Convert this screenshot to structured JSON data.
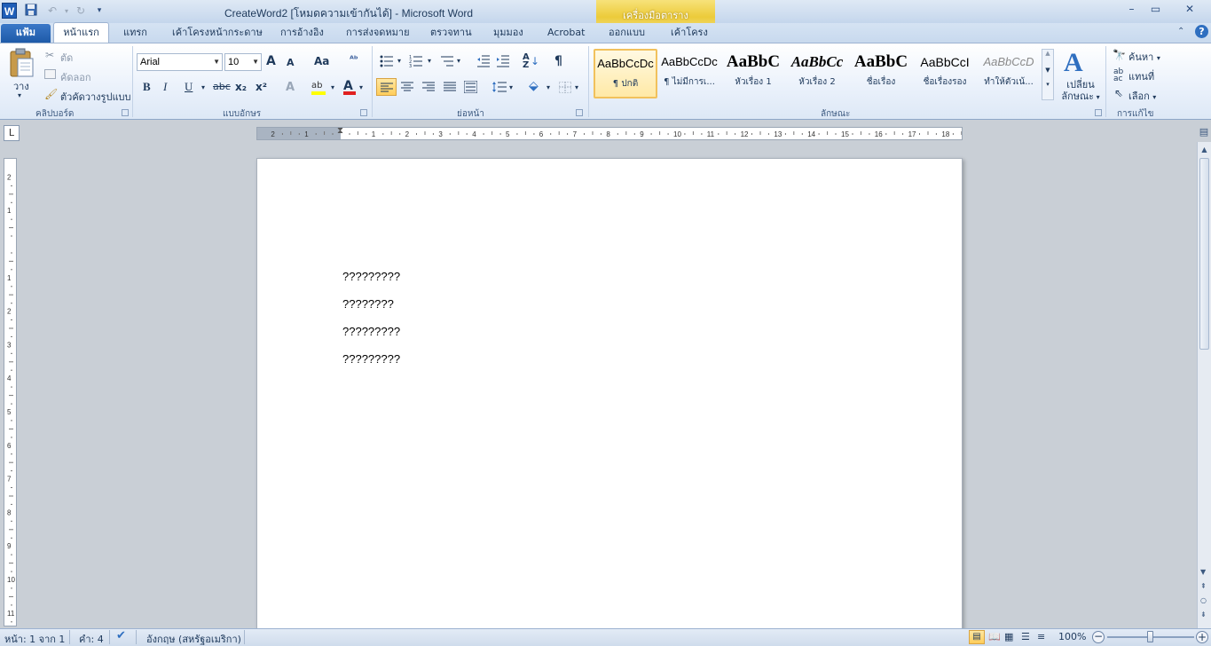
{
  "window": {
    "app_icon": "W",
    "title": "CreateWord2 [โหมดความเข้ากันได้] - Microsoft Word",
    "context_tab_group": "เครื่องมือตาราง",
    "controls": {
      "minimize": "–",
      "maximize": "▭",
      "close": "✕"
    }
  },
  "ribbon_tabs": [
    "แฟ้ม",
    "หน้าแรก",
    "แทรก",
    "เค้าโครงหน้ากระดาษ",
    "การอ้างอิง",
    "การส่งจดหมาย",
    "ตรวจทาน",
    "มุมมอง",
    "Acrobat",
    "ออกแบบ",
    "เค้าโครง"
  ],
  "active_tab": "หน้าแรก",
  "clipboard": {
    "paste": "วาง",
    "cut": "ตัด",
    "copy": "คัดลอก",
    "format_painter": "ตัวคัดวางรูปแบบ",
    "label": "คลิปบอร์ด"
  },
  "font": {
    "name": "Arial",
    "size": "10",
    "grow": "A",
    "shrink": "A",
    "change_case": "Aa",
    "bold": "B",
    "italic": "I",
    "underline": "U",
    "strike": "abc",
    "subscript": "x₂",
    "superscript": "x²",
    "label": "แบบอักษร"
  },
  "paragraph": {
    "label": "ย่อหน้า",
    "pilcrow": "¶"
  },
  "styles": {
    "items": [
      {
        "preview": "AaBbCcDc",
        "name": "¶ ปกติ"
      },
      {
        "preview": "AaBbCcDc",
        "name": "¶ ไม่มีการเ..."
      },
      {
        "preview": "AaBbC",
        "name": "หัวเรื่อง 1"
      },
      {
        "preview": "AaBbCc",
        "name": "หัวเรื่อง 2"
      },
      {
        "preview": "AaBbC",
        "name": "ชื่อเรื่อง"
      },
      {
        "preview": "AaBbCcI",
        "name": "ชื่อเรื่องรอง"
      },
      {
        "preview": "AaBbCcD",
        "name": "ทำให้ตัวเน้..."
      }
    ],
    "change_styles_1": "เปลี่ยน",
    "change_styles_2": "ลักษณะ",
    "label": "ลักษณะ"
  },
  "editing": {
    "find": "ค้นหา",
    "replace": "แทนที่",
    "select": "เลือก",
    "label": "การแก้ไข"
  },
  "document": {
    "paragraphs": [
      "?????????",
      "????????",
      "?????????",
      "?????????"
    ]
  },
  "status": {
    "page": "หน้า: 1 จาก 1",
    "words": "คำ: 4",
    "language": "อังกฤษ (สหรัฐอเมริกา)",
    "zoom": "100%"
  },
  "zoom_level": 1.0,
  "colors": {
    "accent": "#1e5aa8",
    "context": "#eccb3a"
  }
}
